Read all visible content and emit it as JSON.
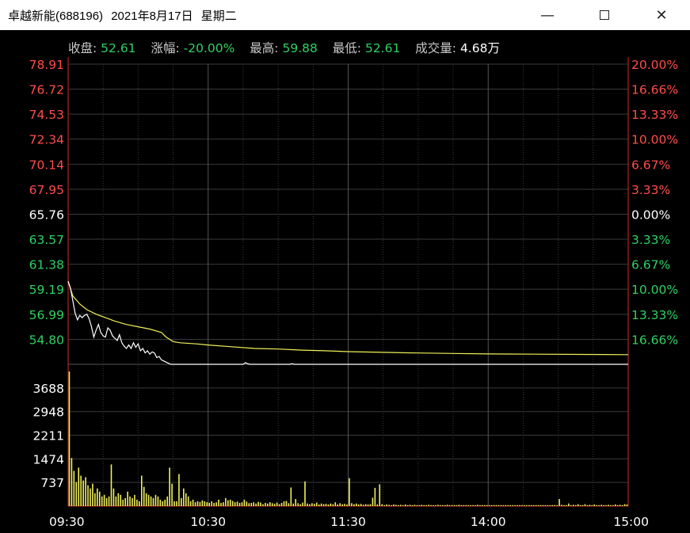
{
  "window": {
    "stock_name": "卓越新能(688196)",
    "date": "2021年8月17日",
    "weekday": "星期二"
  },
  "info": [
    {
      "label": "收盘:",
      "value": "52.61",
      "color": "green"
    },
    {
      "label": "涨幅:",
      "value": "-20.00%",
      "color": "green"
    },
    {
      "label": "最高:",
      "value": "59.88",
      "color": "green"
    },
    {
      "label": "最低:",
      "value": "52.61",
      "color": "green"
    },
    {
      "label": "成交量:",
      "value": "4.68万",
      "color": "white"
    }
  ],
  "colors": {
    "up": "#ff4c4c",
    "down": "#2fd064",
    "flat": "#ffffff",
    "price_line": "#ffffff",
    "avg_line": "#f0f05a",
    "volume_bar": "#f0f05a",
    "grid": "#3a3a3a",
    "grid_strong": "#555555",
    "axis": "#8c1c1c"
  },
  "chart_data": {
    "type": "line",
    "x_ticks": [
      "09:30",
      "10:30",
      "11:30",
      "14:00",
      "15:00"
    ],
    "price_ticks": [
      {
        "price": "78.91",
        "pct": "20.00%",
        "dir": "up"
      },
      {
        "price": "76.72",
        "pct": "16.66%",
        "dir": "up"
      },
      {
        "price": "74.53",
        "pct": "13.33%",
        "dir": "up"
      },
      {
        "price": "72.34",
        "pct": "10.00%",
        "dir": "up"
      },
      {
        "price": "70.14",
        "pct": "6.67%",
        "dir": "up"
      },
      {
        "price": "67.95",
        "pct": "3.33%",
        "dir": "up"
      },
      {
        "price": "65.76",
        "pct": "0.00%",
        "dir": "flat"
      },
      {
        "price": "63.57",
        "pct": "3.33%",
        "dir": "down"
      },
      {
        "price": "61.38",
        "pct": "6.67%",
        "dir": "down"
      },
      {
        "price": "59.19",
        "pct": "10.00%",
        "dir": "down"
      },
      {
        "price": "56.99",
        "pct": "13.33%",
        "dir": "down"
      },
      {
        "price": "54.80",
        "pct": "16.66%",
        "dir": "down"
      }
    ],
    "price_range": [
      52.61,
      78.91
    ],
    "volume_ticks": [
      "3688",
      "2948",
      "2211",
      "1474",
      "737"
    ],
    "volume_range": [
      0,
      4425
    ],
    "total_minutes": 240,
    "price_series": [
      [
        0,
        59.88
      ],
      [
        1,
        59.3
      ],
      [
        2,
        58.2
      ],
      [
        3,
        57.1
      ],
      [
        4,
        56.5
      ],
      [
        5,
        56.9
      ],
      [
        6,
        56.7
      ],
      [
        7,
        56.9
      ],
      [
        8,
        57.0
      ],
      [
        9,
        56.6
      ],
      [
        10,
        55.9
      ],
      [
        11,
        55.0
      ],
      [
        12,
        55.6
      ],
      [
        13,
        56.1
      ],
      [
        14,
        55.4
      ],
      [
        15,
        55.1
      ],
      [
        16,
        55.0
      ],
      [
        17,
        55.8
      ],
      [
        18,
        55.6
      ],
      [
        19,
        55.1
      ],
      [
        20,
        54.9
      ],
      [
        21,
        54.7
      ],
      [
        22,
        55.2
      ],
      [
        23,
        54.5
      ],
      [
        24,
        54.2
      ],
      [
        25,
        54.0
      ],
      [
        26,
        54.3
      ],
      [
        27,
        54.0
      ],
      [
        28,
        54.5
      ],
      [
        29,
        54.1
      ],
      [
        30,
        54.4
      ],
      [
        31,
        53.8
      ],
      [
        32,
        54.0
      ],
      [
        33,
        53.6
      ],
      [
        34,
        53.8
      ],
      [
        35,
        53.5
      ],
      [
        36,
        53.7
      ],
      [
        37,
        53.6
      ],
      [
        38,
        53.2
      ],
      [
        39,
        53.3
      ],
      [
        40,
        53.0
      ],
      [
        41,
        52.9
      ],
      [
        42,
        52.8
      ],
      [
        43,
        52.7
      ],
      [
        44,
        52.61
      ],
      [
        50,
        52.61
      ],
      [
        60,
        52.61
      ],
      [
        70,
        52.61
      ],
      [
        75,
        52.61
      ],
      [
        76,
        52.75
      ],
      [
        77,
        52.65
      ],
      [
        78,
        52.61
      ],
      [
        90,
        52.61
      ],
      [
        95,
        52.61
      ],
      [
        96,
        52.66
      ],
      [
        97,
        52.61
      ],
      [
        120,
        52.61
      ],
      [
        150,
        52.61
      ],
      [
        180,
        52.61
      ],
      [
        210,
        52.61
      ],
      [
        240,
        52.61
      ]
    ],
    "avg_series": [
      [
        0,
        59.88
      ],
      [
        2,
        58.6
      ],
      [
        5,
        57.9
      ],
      [
        8,
        57.4
      ],
      [
        12,
        57.0
      ],
      [
        16,
        56.7
      ],
      [
        20,
        56.4
      ],
      [
        25,
        56.1
      ],
      [
        30,
        55.9
      ],
      [
        35,
        55.7
      ],
      [
        40,
        55.4
      ],
      [
        42,
        55.0
      ],
      [
        45,
        54.6
      ],
      [
        48,
        54.5
      ],
      [
        55,
        54.4
      ],
      [
        60,
        54.3
      ],
      [
        70,
        54.15
      ],
      [
        80,
        54.0
      ],
      [
        90,
        53.95
      ],
      [
        100,
        53.85
      ],
      [
        110,
        53.8
      ],
      [
        120,
        53.72
      ],
      [
        135,
        53.66
      ],
      [
        150,
        53.6
      ],
      [
        165,
        53.56
      ],
      [
        180,
        53.52
      ],
      [
        200,
        53.5
      ],
      [
        220,
        53.48
      ],
      [
        240,
        53.46
      ]
    ],
    "volume_bars": [
      [
        0,
        4200
      ],
      [
        1,
        1500
      ],
      [
        2,
        1100
      ],
      [
        3,
        750
      ],
      [
        4,
        1200
      ],
      [
        5,
        950
      ],
      [
        6,
        800
      ],
      [
        7,
        900
      ],
      [
        8,
        650
      ],
      [
        9,
        550
      ],
      [
        10,
        700
      ],
      [
        11,
        400
      ],
      [
        12,
        550
      ],
      [
        13,
        450
      ],
      [
        14,
        300
      ],
      [
        15,
        350
      ],
      [
        16,
        250
      ],
      [
        17,
        300
      ],
      [
        18,
        1300
      ],
      [
        19,
        550
      ],
      [
        20,
        300
      ],
      [
        21,
        400
      ],
      [
        22,
        350
      ],
      [
        23,
        200
      ],
      [
        24,
        250
      ],
      [
        25,
        450
      ],
      [
        26,
        300
      ],
      [
        27,
        250
      ],
      [
        28,
        350
      ],
      [
        29,
        200
      ],
      [
        30,
        150
      ],
      [
        31,
        950
      ],
      [
        32,
        600
      ],
      [
        33,
        400
      ],
      [
        34,
        350
      ],
      [
        35,
        300
      ],
      [
        36,
        250
      ],
      [
        37,
        350
      ],
      [
        38,
        300
      ],
      [
        39,
        200
      ],
      [
        40,
        150
      ],
      [
        41,
        200
      ],
      [
        42,
        300
      ],
      [
        43,
        1200
      ],
      [
        44,
        700
      ],
      [
        45,
        150
      ],
      [
        46,
        150
      ],
      [
        47,
        1000
      ],
      [
        48,
        250
      ],
      [
        49,
        550
      ],
      [
        50,
        400
      ],
      [
        51,
        300
      ],
      [
        52,
        150
      ],
      [
        53,
        200
      ],
      [
        54,
        120
      ],
      [
        55,
        150
      ],
      [
        56,
        130
      ],
      [
        57,
        180
      ],
      [
        58,
        150
      ],
      [
        59,
        120
      ],
      [
        60,
        100
      ],
      [
        61,
        150
      ],
      [
        62,
        100
      ],
      [
        63,
        120
      ],
      [
        64,
        200
      ],
      [
        65,
        100
      ],
      [
        66,
        120
      ],
      [
        67,
        250
      ],
      [
        68,
        180
      ],
      [
        69,
        200
      ],
      [
        70,
        160
      ],
      [
        71,
        120
      ],
      [
        72,
        140
      ],
      [
        73,
        100
      ],
      [
        74,
        120
      ],
      [
        75,
        200
      ],
      [
        76,
        140
      ],
      [
        77,
        90
      ],
      [
        78,
        100
      ],
      [
        79,
        120
      ],
      [
        80,
        80
      ],
      [
        81,
        130
      ],
      [
        82,
        110
      ],
      [
        83,
        60
      ],
      [
        84,
        100
      ],
      [
        85,
        80
      ],
      [
        86,
        120
      ],
      [
        87,
        90
      ],
      [
        88,
        70
      ],
      [
        89,
        110
      ],
      [
        90,
        60
      ],
      [
        91,
        100
      ],
      [
        92,
        150
      ],
      [
        93,
        160
      ],
      [
        94,
        90
      ],
      [
        95,
        580
      ],
      [
        96,
        80
      ],
      [
        97,
        220
      ],
      [
        98,
        90
      ],
      [
        99,
        60
      ],
      [
        100,
        110
      ],
      [
        101,
        770
      ],
      [
        102,
        80
      ],
      [
        103,
        60
      ],
      [
        104,
        90
      ],
      [
        105,
        70
      ],
      [
        106,
        110
      ],
      [
        107,
        50
      ],
      [
        108,
        80
      ],
      [
        109,
        60
      ],
      [
        110,
        70
      ],
      [
        111,
        50
      ],
      [
        112,
        80
      ],
      [
        113,
        60
      ],
      [
        114,
        120
      ],
      [
        115,
        50
      ],
      [
        116,
        90
      ],
      [
        117,
        60
      ],
      [
        118,
        70
      ],
      [
        119,
        50
      ],
      [
        120,
        870
      ],
      [
        121,
        90
      ],
      [
        122,
        60
      ],
      [
        123,
        80
      ],
      [
        124,
        50
      ],
      [
        125,
        70
      ],
      [
        126,
        40
      ],
      [
        127,
        60
      ],
      [
        128,
        50
      ],
      [
        129,
        60
      ],
      [
        130,
        260
      ],
      [
        131,
        570
      ],
      [
        132,
        50
      ],
      [
        133,
        680
      ],
      [
        134,
        60
      ],
      [
        135,
        30
      ],
      [
        136,
        50
      ],
      [
        137,
        40
      ],
      [
        138,
        30
      ],
      [
        139,
        50
      ],
      [
        140,
        40
      ],
      [
        141,
        30
      ],
      [
        142,
        40
      ],
      [
        143,
        30
      ],
      [
        144,
        50
      ],
      [
        145,
        30
      ],
      [
        146,
        40
      ],
      [
        147,
        30
      ],
      [
        148,
        40
      ],
      [
        149,
        30
      ],
      [
        150,
        30
      ],
      [
        151,
        40
      ],
      [
        152,
        30
      ],
      [
        153,
        30
      ],
      [
        154,
        40
      ],
      [
        155,
        30
      ],
      [
        156,
        30
      ],
      [
        157,
        30
      ],
      [
        158,
        40
      ],
      [
        159,
        30
      ],
      [
        160,
        30
      ],
      [
        161,
        30
      ],
      [
        162,
        40
      ],
      [
        163,
        30
      ],
      [
        164,
        30
      ],
      [
        165,
        30
      ],
      [
        166,
        30
      ],
      [
        167,
        40
      ],
      [
        168,
        30
      ],
      [
        169,
        30
      ],
      [
        170,
        30
      ],
      [
        171,
        30
      ],
      [
        172,
        30
      ],
      [
        173,
        30
      ],
      [
        174,
        30
      ],
      [
        175,
        40
      ],
      [
        176,
        30
      ],
      [
        177,
        30
      ],
      [
        178,
        30
      ],
      [
        179,
        30
      ],
      [
        180,
        30
      ],
      [
        181,
        30
      ],
      [
        182,
        30
      ],
      [
        183,
        30
      ],
      [
        184,
        30
      ],
      [
        185,
        30
      ],
      [
        186,
        30
      ],
      [
        187,
        30
      ],
      [
        188,
        30
      ],
      [
        189,
        30
      ],
      [
        190,
        30
      ],
      [
        191,
        30
      ],
      [
        192,
        30
      ],
      [
        193,
        30
      ],
      [
        194,
        30
      ],
      [
        195,
        30
      ],
      [
        196,
        30
      ],
      [
        197,
        30
      ],
      [
        198,
        30
      ],
      [
        199,
        30
      ],
      [
        200,
        30
      ],
      [
        201,
        30
      ],
      [
        202,
        30
      ],
      [
        203,
        30
      ],
      [
        204,
        30
      ],
      [
        205,
        30
      ],
      [
        206,
        30
      ],
      [
        207,
        30
      ],
      [
        208,
        30
      ],
      [
        209,
        30
      ],
      [
        210,
        220
      ],
      [
        211,
        40
      ],
      [
        212,
        30
      ],
      [
        213,
        30
      ],
      [
        214,
        80
      ],
      [
        215,
        30
      ],
      [
        216,
        40
      ],
      [
        217,
        30
      ],
      [
        218,
        60
      ],
      [
        219,
        30
      ],
      [
        220,
        30
      ],
      [
        221,
        60
      ],
      [
        222,
        30
      ],
      [
        223,
        40
      ],
      [
        224,
        30
      ],
      [
        225,
        50
      ],
      [
        226,
        30
      ],
      [
        227,
        30
      ],
      [
        228,
        40
      ],
      [
        229,
        30
      ],
      [
        230,
        30
      ],
      [
        231,
        40
      ],
      [
        232,
        30
      ],
      [
        233,
        30
      ],
      [
        234,
        50
      ],
      [
        235,
        30
      ],
      [
        236,
        40
      ],
      [
        237,
        30
      ],
      [
        238,
        60
      ],
      [
        239,
        50
      ]
    ]
  }
}
